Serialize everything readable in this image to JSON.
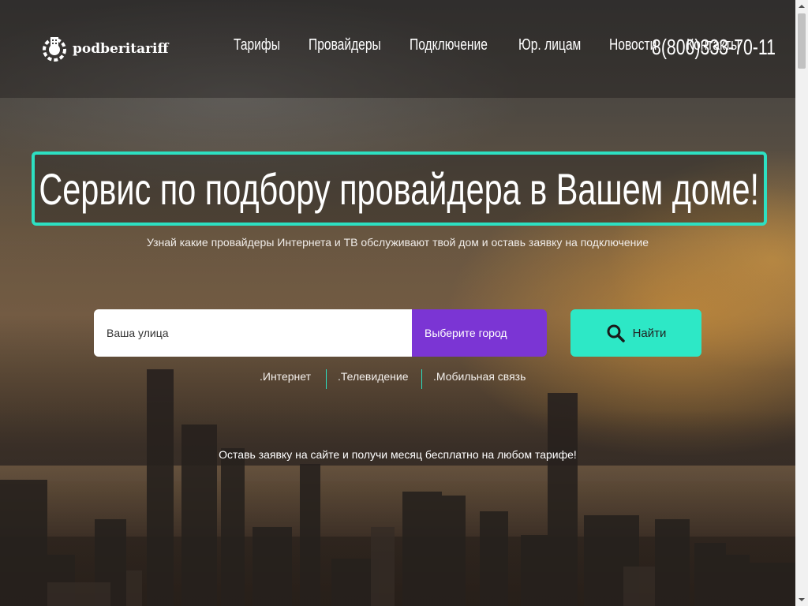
{
  "brand": {
    "name": "podberitariff"
  },
  "nav": [
    {
      "label": "Тарифы"
    },
    {
      "label": "Провайдеры"
    },
    {
      "label": "Подключение"
    },
    {
      "label": "Юр. лицам"
    },
    {
      "label": "Новости"
    },
    {
      "label": "Контакты"
    }
  ],
  "phone": "8(800)333-70-11",
  "hero": {
    "title": "Сервис по подбору провайдера в Вашем доме!",
    "subtitle": "Узнай какие провайдеры Интернета и ТВ обслуживают твой дом и оставь заявку на подключение"
  },
  "search": {
    "street_placeholder": "Ваша улица",
    "city_label": "Выберите город",
    "find_label": "Найти"
  },
  "services": [
    {
      "label": ".Интернет"
    },
    {
      "label": ".Телевидение"
    },
    {
      "label": ".Мобильная связь"
    }
  ],
  "promo": "Оставь заявку на сайте и получи месяц бесплатно на любом тарифе!",
  "colors": {
    "accent": "#2de0c2",
    "city_select": "#7b35d4",
    "find_button": "#2de8c6"
  },
  "icons": [
    "logo-icon",
    "search-icon"
  ]
}
